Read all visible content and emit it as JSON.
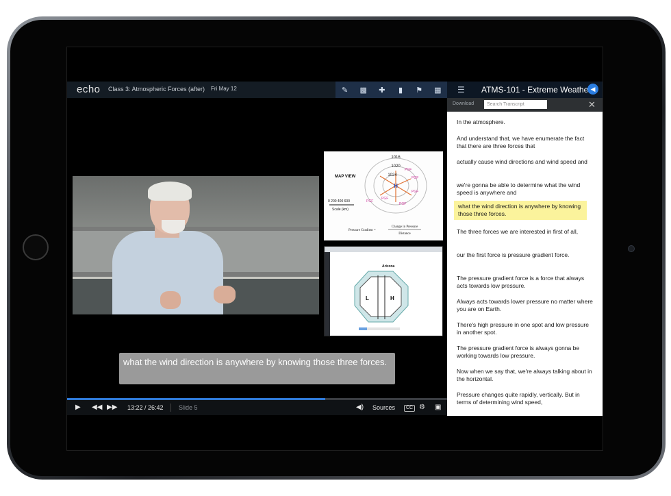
{
  "app": {
    "logo": "echo",
    "class_title": "Class 3: Atmospheric Forces (after)",
    "class_date": "Fri May 12",
    "toolbar_icons": [
      "notes-icon",
      "discussion-icon",
      "question-icon",
      "bookmark-icon",
      "flag-icon",
      "confusion-icon"
    ]
  },
  "transcript": {
    "course_title": "ATMS-101 - Extreme Weather",
    "download_label": "Download",
    "search_placeholder": "Search Transcript",
    "segments": [
      "In the atmosphere.",
      "And understand that, we have enumerate the fact that there are three forces that",
      "actually cause wind directions and wind speed and",
      "we're gonna be able to determine what the wind speed is anywhere and",
      "what the wind direction is anywhere by knowing those three forces.",
      "The three forces we are interested in first of all,",
      "our the first force is pressure gradient force.",
      "The pressure gradient force is a force that always acts towards low pressure.",
      "Always acts towards lower pressure no matter where you are on Earth.",
      "There's high pressure in one spot and low pressure in another spot.",
      "The pressure gradient force is always gonna be working towards low pressure.",
      "Now when we say that, we're always talking about in the horizontal.",
      "Pressure changes quite rapidly, vertically. But in terms of determining wind speed,"
    ],
    "highlight_index": 4
  },
  "slide1": {
    "map_label": "MAP VIEW",
    "isobars": [
      "1016",
      "1020",
      "1024"
    ],
    "center": "H",
    "force_label": "PGF",
    "scale_ticks": "0  200 400 600",
    "scale_label": "Scale (km)",
    "formula_left": "Pressure Gradient  =",
    "formula_num": "Change in Pressure",
    "formula_den": "Distance"
  },
  "slide2": {
    "title": "Arizona",
    "low": "L",
    "high": "H"
  },
  "caption": {
    "text": "what the wind direction is anywhere by knowing those three forces."
  },
  "player": {
    "current_time": "13:22",
    "duration": "26:42",
    "time_display": "13:22 / 26:42",
    "slide": "Slide 5",
    "sources_label": "Sources",
    "cc_label": "CC",
    "progress": 0.68
  }
}
